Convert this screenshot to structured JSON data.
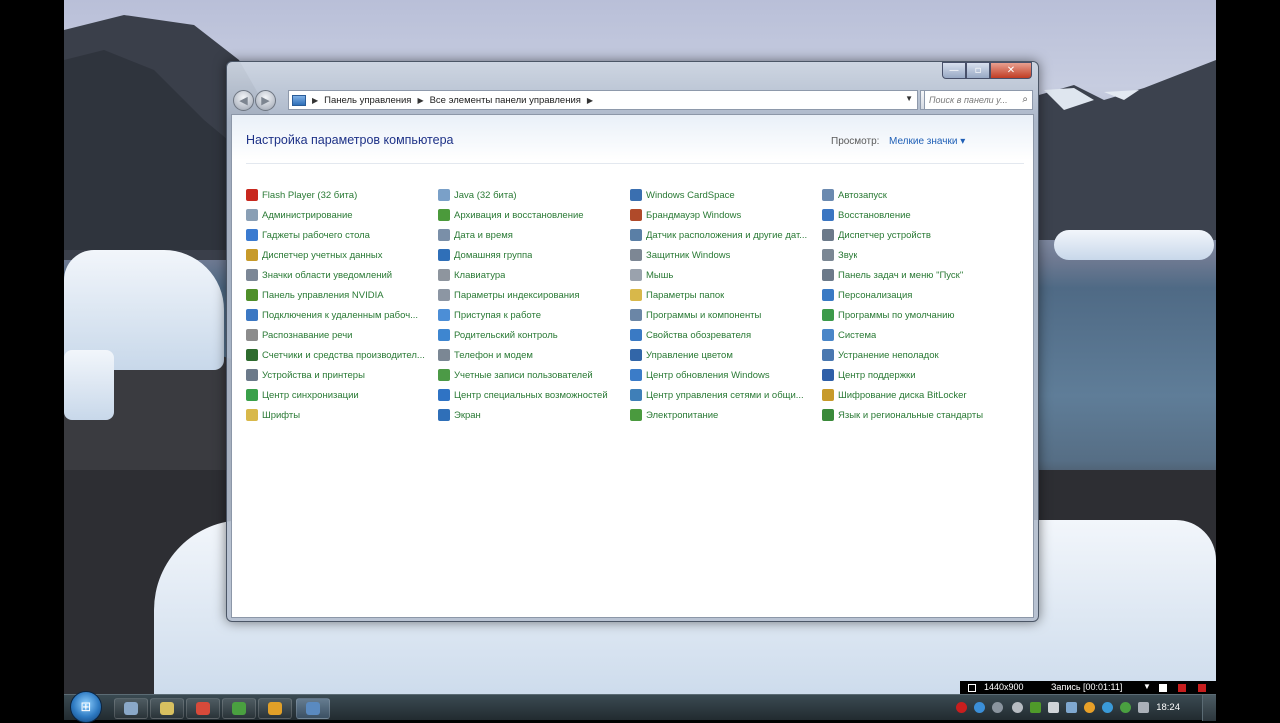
{
  "window": {
    "controls": {
      "minimize": "—",
      "maximize": "▫",
      "close": "✕"
    }
  },
  "address": {
    "crumbs": [
      "Панель управления",
      "Все элементы панели управления"
    ],
    "search_placeholder": "Поиск в панели у..."
  },
  "header": {
    "title": "Настройка параметров компьютера",
    "view_label": "Просмотр:",
    "view_value": "Мелкие значки ▾"
  },
  "columns": [
    [
      {
        "label": "Flash Player (32 бита)",
        "icon": "flash-icon",
        "color": "#c8281e"
      },
      {
        "label": "Администрирование",
        "icon": "admin-tools-icon",
        "color": "#8a9fb5"
      },
      {
        "label": "Гаджеты рабочего стола",
        "icon": "gadgets-icon",
        "color": "#3b7bd0"
      },
      {
        "label": "Диспетчер учетных данных",
        "icon": "credentials-icon",
        "color": "#c79a2a"
      },
      {
        "label": "Значки области уведомлений",
        "icon": "notification-icons-icon",
        "color": "#7c8796"
      },
      {
        "label": "Панель управления NVIDIA",
        "icon": "nvidia-icon",
        "color": "#4f8f2a"
      },
      {
        "label": "Подключения к удаленным рабоч...",
        "icon": "remote-desktop-icon",
        "color": "#3c78c3"
      },
      {
        "label": "Распознавание речи",
        "icon": "microphone-icon",
        "color": "#8c8c8c"
      },
      {
        "label": "Счетчики и средства производител...",
        "icon": "performance-icon",
        "color": "#2e6b2e"
      },
      {
        "label": "Устройства и принтеры",
        "icon": "printer-icon",
        "color": "#6c7a8a"
      },
      {
        "label": "Центр синхронизации",
        "icon": "sync-icon",
        "color": "#3aa04a"
      },
      {
        "label": "Шрифты",
        "icon": "fonts-icon",
        "color": "#d8b84a"
      }
    ],
    [
      {
        "label": "Java (32 бита)",
        "icon": "java-icon",
        "color": "#7aa0c8"
      },
      {
        "label": "Архивация и восстановление",
        "icon": "backup-icon",
        "color": "#4b9a3b"
      },
      {
        "label": "Дата и время",
        "icon": "clock-icon",
        "color": "#7a8fa8"
      },
      {
        "label": "Домашняя группа",
        "icon": "homegroup-icon",
        "color": "#2f6fb8"
      },
      {
        "label": "Клавиатура",
        "icon": "keyboard-icon",
        "color": "#8e959e"
      },
      {
        "label": "Параметры индексирования",
        "icon": "indexing-icon",
        "color": "#8c96a3"
      },
      {
        "label": "Приступая к работе",
        "icon": "getting-started-icon",
        "color": "#4c8ed6"
      },
      {
        "label": "Родительский контроль",
        "icon": "parental-controls-icon",
        "color": "#3e86d0"
      },
      {
        "label": "Телефон и модем",
        "icon": "phone-icon",
        "color": "#7b8794"
      },
      {
        "label": "Учетные записи пользователей",
        "icon": "user-accounts-icon",
        "color": "#4c9a46"
      },
      {
        "label": "Центр специальных возможностей",
        "icon": "accessibility-icon",
        "color": "#2f73c4"
      },
      {
        "label": "Экран",
        "icon": "display-icon",
        "color": "#2f6fb8"
      }
    ],
    [
      {
        "label": "Windows CardSpace",
        "icon": "cardspace-icon",
        "color": "#3a6fb0"
      },
      {
        "label": "Брандмауэр Windows",
        "icon": "firewall-icon",
        "color": "#b04a2a"
      },
      {
        "label": "Датчик расположения и другие дат...",
        "icon": "location-sensor-icon",
        "color": "#5a7fa6"
      },
      {
        "label": "Защитник Windows",
        "icon": "defender-icon",
        "color": "#7d8794"
      },
      {
        "label": "Мышь",
        "icon": "mouse-icon",
        "color": "#9aa2ad"
      },
      {
        "label": "Параметры папок",
        "icon": "folder-options-icon",
        "color": "#d8b84a"
      },
      {
        "label": "Программы и компоненты",
        "icon": "programs-icon",
        "color": "#6b86a6"
      },
      {
        "label": "Свойства обозревателя",
        "icon": "internet-options-icon",
        "color": "#3a7ac4"
      },
      {
        "label": "Управление цветом",
        "icon": "color-management-icon",
        "color": "#3266a8"
      },
      {
        "label": "Центр обновления Windows",
        "icon": "windows-update-icon",
        "color": "#3b7cc8"
      },
      {
        "label": "Центр управления сетями и общи...",
        "icon": "network-icon",
        "color": "#3f7fb8"
      },
      {
        "label": "Электропитание",
        "icon": "power-icon",
        "color": "#4a9a3e"
      }
    ],
    [
      {
        "label": "Автозапуск",
        "icon": "autoplay-icon",
        "color": "#6b8ab0"
      },
      {
        "label": "Восстановление",
        "icon": "recovery-icon",
        "color": "#3b76c2"
      },
      {
        "label": "Диспетчер устройств",
        "icon": "device-manager-icon",
        "color": "#6c7a8a"
      },
      {
        "label": "Звук",
        "icon": "speaker-icon",
        "color": "#7b8794"
      },
      {
        "label": "Панель задач и меню \"Пуск\"",
        "icon": "taskbar-icon",
        "color": "#6c7a8a"
      },
      {
        "label": "Персонализация",
        "icon": "personalization-icon",
        "color": "#3a7ac4"
      },
      {
        "label": "Программы по умолчанию",
        "icon": "default-programs-icon",
        "color": "#3c9a4a"
      },
      {
        "label": "Система",
        "icon": "system-icon",
        "color": "#4a86c8"
      },
      {
        "label": "Устранение неполадок",
        "icon": "troubleshooting-icon",
        "color": "#4a78b0"
      },
      {
        "label": "Центр поддержки",
        "icon": "action-center-icon",
        "color": "#2f5fa8"
      },
      {
        "label": "Шифрование диска BitLocker",
        "icon": "bitlocker-icon",
        "color": "#c79a2a"
      },
      {
        "label": "Язык и региональные стандарты",
        "icon": "region-language-icon",
        "color": "#3a8a3a"
      }
    ]
  ],
  "recorder": {
    "resolution": "1440x900",
    "status": "Запись [00:01:11]"
  },
  "taskbar": {
    "clock": "18:24",
    "pinned": [
      {
        "name": "taskbar-app-explorer",
        "icon": "file-manager-icon",
        "color": "#8aa8c8"
      },
      {
        "name": "taskbar-app-folder",
        "icon": "folder-icon",
        "color": "#d8c060"
      },
      {
        "name": "taskbar-app-chrome",
        "icon": "chrome-icon",
        "color": "#d84a3a"
      },
      {
        "name": "taskbar-app-torrent",
        "icon": "torrent-icon",
        "color": "#4aa040"
      },
      {
        "name": "taskbar-app-chrome-2",
        "icon": "chrome-icon",
        "color": "#e2a028"
      },
      {
        "name": "taskbar-app-control-panel",
        "icon": "control-panel-icon",
        "color": "#5a8ac0"
      }
    ]
  }
}
